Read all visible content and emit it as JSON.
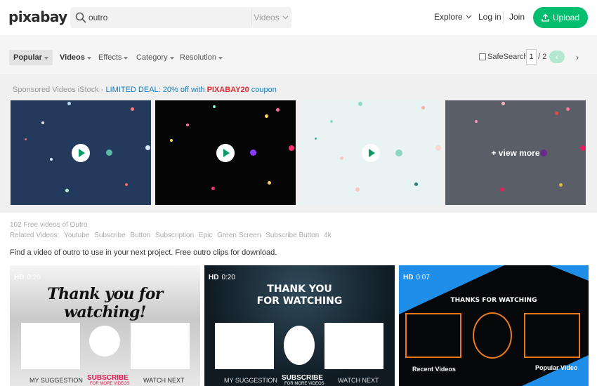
{
  "header": {
    "logo": "pixabay",
    "search": {
      "value": "outro",
      "type_label": "Videos"
    },
    "nav": {
      "explore": "Explore",
      "login": "Log in",
      "join": "Join",
      "upload": "Upload"
    }
  },
  "filters": {
    "items": [
      "Popular",
      "Videos",
      "Effects",
      "Category",
      "Resolution"
    ],
    "safesearch": "SafeSearch",
    "pagination": {
      "current": "1",
      "total": "/ 2"
    }
  },
  "sponsored": {
    "prefix": "Sponsored Videos iStock - ",
    "deal": "LIMITED DEAL: 20% off with ",
    "code": "PIXABAY20",
    "suffix": " coupon",
    "view_more": "+ view more"
  },
  "results": {
    "count": "102 Free videos of Outro",
    "related_label": "Related Videos:",
    "related": [
      "Youtube",
      "Subscribe",
      "Button",
      "Subscription",
      "Epic",
      "Green Screen",
      "Subscribe Button",
      "4k"
    ],
    "description": "Find a video of outro to use in your next project. Free outro clips for download."
  },
  "videos": [
    {
      "quality": "HD",
      "duration": "0:20",
      "title": "Thank you for watching!",
      "left_label": "MY SUGGESTION",
      "center_label": "SUBSCRIBE",
      "center_sub": "FOR MORE VIDEOS",
      "right_label": "WATCH NEXT"
    },
    {
      "quality": "HD",
      "duration": "0:20",
      "title_line1": "THANK YOU",
      "title_line2": "FOR WATCHING",
      "left_label": "MY SUGGESTION",
      "center_label": "SUBSCRIBE",
      "center_sub": "FOR MORE VIDEOS",
      "right_label": "WATCH NEXT"
    },
    {
      "quality": "HD",
      "duration": "0:07",
      "title": "THANKS FOR WATCHING",
      "left_label": "Recent Videos",
      "right_label": "Popular Video"
    }
  ],
  "colors": {
    "brand_green": "#02be6e",
    "link_blue": "#1a7bb8",
    "coupon_red": "#e22d30",
    "accent_orange": "#e67a1e"
  }
}
